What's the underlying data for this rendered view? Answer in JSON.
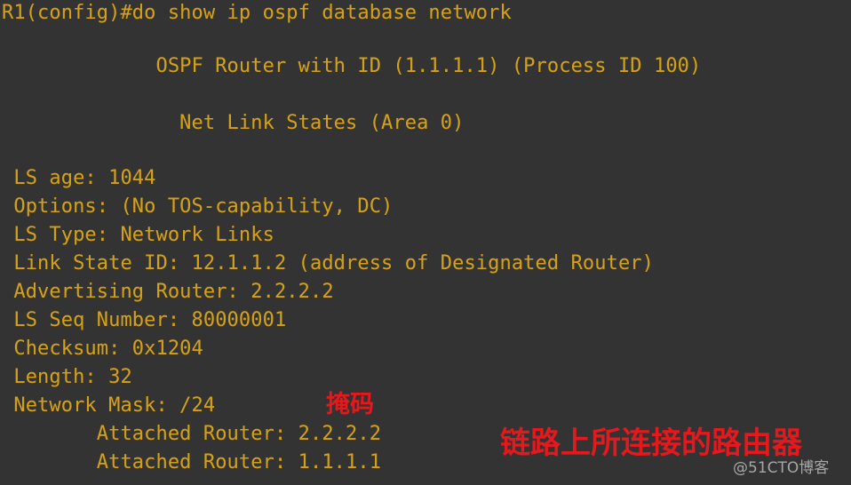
{
  "terminal": {
    "background_color": "#333333",
    "text_color": "#d4a017",
    "prompt_line": "R1(config)#do show ip ospf database network",
    "header_lines": [
      "             OSPF Router with ID (1.1.1.1) (Process ID 100)",
      "               Net Link States (Area 0)"
    ],
    "body_lines": [
      " LS age: 1044",
      " Options: (No TOS-capability, DC)",
      " LS Type: Network Links",
      " Link State ID: 12.1.1.2 (address of Designated Router)",
      " Advertising Router: 2.2.2.2",
      " LS Seq Number: 80000001",
      " Checksum: 0x1204",
      " Length: 32",
      " Network Mask: /24",
      "        Attached Router: 2.2.2.2",
      "        Attached Router: 1.1.1.1"
    ],
    "fields": {
      "ls_age": "1044",
      "options": "(No TOS-capability, DC)",
      "ls_type": "Network Links",
      "link_state_id": "12.1.1.2",
      "link_state_id_note": "(address of Designated Router)",
      "advertising_router": "2.2.2.2",
      "ls_seq_number": "80000001",
      "checksum": "0x1204",
      "length": "32",
      "network_mask": "/24",
      "attached_routers": [
        "2.2.2.2",
        "1.1.1.1"
      ],
      "router_id": "1.1.1.1",
      "process_id": "100",
      "area": "0"
    }
  },
  "annotations": {
    "color": "#e3191e",
    "mask_label": "掩码",
    "attached_routers_label": "链路上所连接的路由器"
  },
  "watermark": {
    "text": "@51CTO博客"
  }
}
